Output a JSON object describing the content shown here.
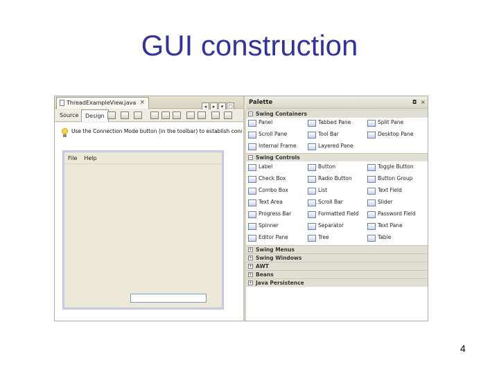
{
  "slide": {
    "title": "GUI construction",
    "page_number": "4"
  },
  "editor": {
    "file_tab": "ThreadExampleView.java",
    "file_tab_close": "×",
    "nav_buttons": [
      "◂",
      "▸",
      "▾",
      "□"
    ],
    "view_tabs": {
      "source": "Source",
      "design": "Design"
    },
    "hint_text": "Use the Connection Mode button (in the toolbar) to establish connections",
    "menubar": [
      "File",
      "Help"
    ]
  },
  "palette": {
    "title": "Palette",
    "window_controls": [
      "◘",
      "×"
    ],
    "categories": [
      {
        "label": "Swing Containers",
        "expander": "−"
      },
      {
        "label": "Swing Controls",
        "expander": "−"
      },
      {
        "label": "Swing Menus",
        "expander": "+"
      },
      {
        "label": "Swing Windows",
        "expander": "+"
      },
      {
        "label": "AWT",
        "expander": "+"
      },
      {
        "label": "Beans",
        "expander": "+"
      },
      {
        "label": "Java Persistence",
        "expander": "+"
      }
    ],
    "containers": [
      "Panel",
      "Tabbed Pane",
      "Split Pane",
      "Scroll Pane",
      "Tool Bar",
      "Desktop Pane",
      "Internal Frame",
      "Layered Pane"
    ],
    "controls": [
      "Label",
      "Button",
      "Toggle Button",
      "Check Box",
      "Radio Button",
      "Button Group",
      "Combo Box",
      "List",
      "Text Field",
      "Text Area",
      "Scroll Bar",
      "Slider",
      "Progress Bar",
      "Formatted Field",
      "Password Field",
      "Spinner",
      "Separator",
      "Text Pane",
      "Editor Pane",
      "Tree",
      "Table"
    ]
  },
  "colors": {
    "title": "#333399",
    "chrome": "#ece9d8",
    "frame_border": "#c6c8e4"
  }
}
